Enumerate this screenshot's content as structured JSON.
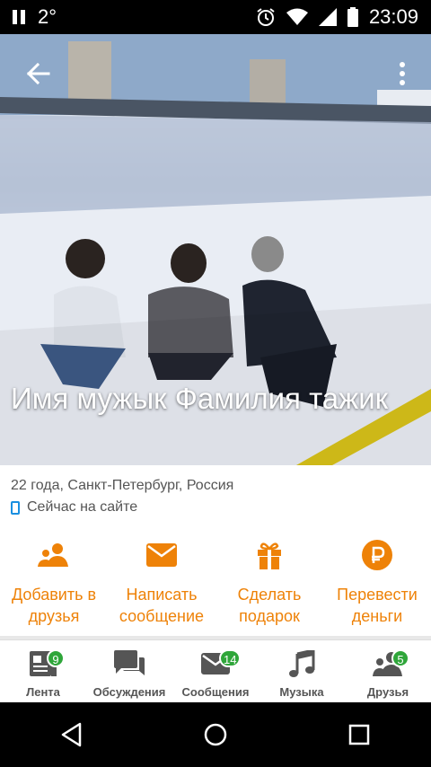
{
  "status_bar": {
    "indicator": "2°",
    "time": "23:09",
    "icons": [
      "pause-icon",
      "alarm-icon",
      "wifi-icon",
      "signal-icon",
      "battery-icon"
    ]
  },
  "profile": {
    "name": "Имя мужык Фамилия тажик",
    "details": "22 года, Санкт-Петербург, Россия",
    "online_status": "Сейчас на сайте"
  },
  "actions": [
    {
      "label": "Добавить в друзья",
      "icon": "add-friend-icon"
    },
    {
      "label": "Написать сообщение",
      "icon": "envelope-icon"
    },
    {
      "label": "Сделать подарок",
      "icon": "gift-icon"
    },
    {
      "label": "Перевести деньги",
      "icon": "ruble-icon"
    }
  ],
  "tabs": [
    {
      "label": "Лента",
      "badge": "9",
      "icon": "feed-icon"
    },
    {
      "label": "Обсуждения",
      "badge": "",
      "icon": "discussions-icon"
    },
    {
      "label": "Сообщения",
      "badge": "14",
      "icon": "messages-icon"
    },
    {
      "label": "Музыка",
      "badge": "",
      "icon": "music-icon"
    },
    {
      "label": "Друзья",
      "badge": "5",
      "icon": "friends-icon"
    }
  ],
  "colors": {
    "accent": "#ee8208",
    "badge": "#2fa63a",
    "online": "#1a8fe0"
  }
}
